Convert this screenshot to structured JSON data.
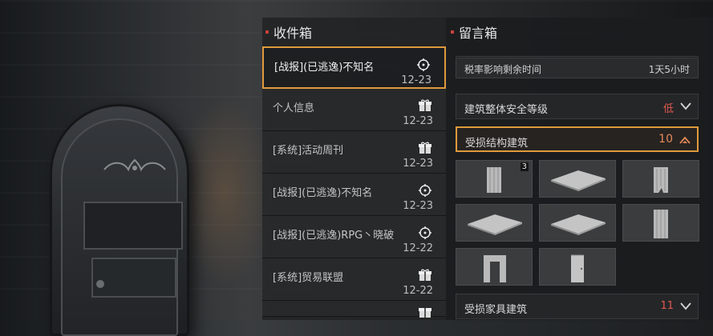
{
  "inbox": {
    "title": "收件箱",
    "items": [
      {
        "subject": "[战报](已逃逸)不知名",
        "date": "12-23",
        "icon": "crosshair-icon"
      },
      {
        "subject": "个人信息",
        "date": "12-23",
        "icon": "gift-icon"
      },
      {
        "subject": "[系统]活动周刊",
        "date": "12-23",
        "icon": "gift-icon"
      },
      {
        "subject": "[战报](已逃逸)不知名",
        "date": "12-23",
        "icon": "crosshair-icon"
      },
      {
        "subject": "[战报](已逃逸)RPG丶晓破",
        "date": "12-22",
        "icon": "crosshair-icon"
      },
      {
        "subject": "[系统]贸易联盟",
        "date": "12-22",
        "icon": "gift-icon"
      }
    ]
  },
  "messages": {
    "title": "留言箱"
  },
  "report": {
    "tax_label": "税率影响剩余时间",
    "tax_value": "1天5小时",
    "safety_label": "建筑整体安全等级",
    "safety_value": "低",
    "damaged_structures_label": "受损结构建筑",
    "damaged_structures_count": "10",
    "damaged_furniture_label": "受损家具建筑",
    "damaged_furniture_count": "11",
    "structure_tiles": [
      {
        "kind": "wall-panel",
        "badge": "3"
      },
      {
        "kind": "floor-tile",
        "badge": ""
      },
      {
        "kind": "damaged-wall",
        "badge": ""
      },
      {
        "kind": "floor-tile",
        "badge": ""
      },
      {
        "kind": "floor-tile",
        "badge": ""
      },
      {
        "kind": "wall-panel",
        "badge": ""
      },
      {
        "kind": "doorframe",
        "badge": ""
      },
      {
        "kind": "door",
        "badge": ""
      }
    ]
  },
  "colors": {
    "accent": "#e09a3c",
    "danger": "#e05a4f",
    "header_mark": "#c8413a"
  }
}
